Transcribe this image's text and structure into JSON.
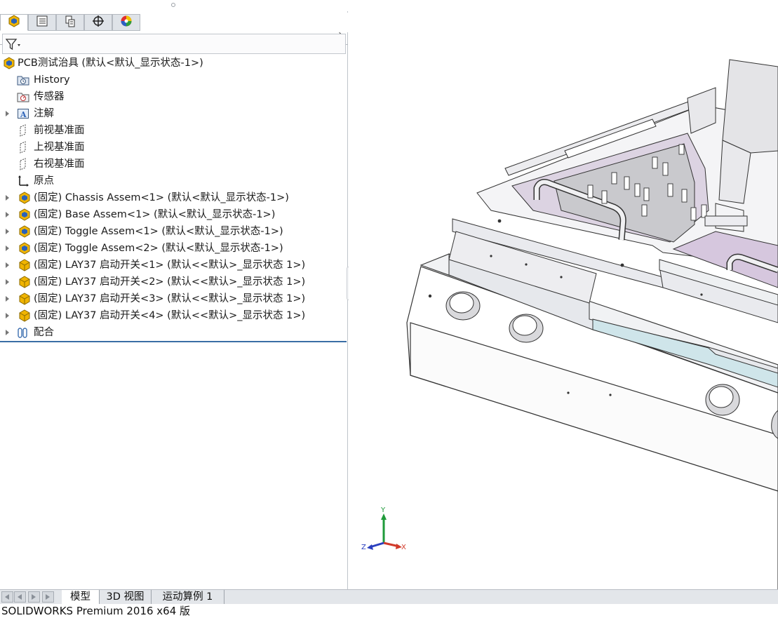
{
  "colors": {
    "accent": "#3a6ea5",
    "assembly_icon": "#f0b400",
    "assembly_icon_blue": "#2b62b8",
    "model_purple": "#d6c7de"
  },
  "panel": {
    "tabs": [
      {
        "name": "feature-manager-tab",
        "icon": "assembly-icon"
      },
      {
        "name": "property-manager-tab",
        "icon": "property-list-icon"
      },
      {
        "name": "configuration-manager-tab",
        "icon": "configuration-icon"
      },
      {
        "name": "dimxpert-tab",
        "icon": "crosshair-icon"
      },
      {
        "name": "display-manager-tab",
        "icon": "color-wheel-icon"
      }
    ],
    "more_glyph": "›",
    "filter_icon": "filter-icon"
  },
  "tree": {
    "root": "PCB测试治具  (默认<默认_显示状态-1>)",
    "items": [
      {
        "label": "History",
        "icon": "history-folder-icon"
      },
      {
        "label": "传感器",
        "icon": "sensor-icon"
      },
      {
        "label": "注解",
        "icon": "annotation-icon"
      },
      {
        "label": "前视基准面",
        "icon": "plane-icon"
      },
      {
        "label": "上视基准面",
        "icon": "plane-icon"
      },
      {
        "label": "右视基准面",
        "icon": "plane-icon"
      },
      {
        "label": "原点",
        "icon": "origin-icon"
      },
      {
        "label": "(固定) Chassis Assem<1> (默认<默认_显示状态-1>)",
        "icon": "assembly-icon"
      },
      {
        "label": "(固定) Base Assem<1> (默认<默认_显示状态-1>)",
        "icon": "assembly-icon"
      },
      {
        "label": "(固定) Toggle Assem<1> (默认<默认_显示状态-1>)",
        "icon": "assembly-icon"
      },
      {
        "label": "(固定) Toggle Assem<2> (默认<默认_显示状态-1>)",
        "icon": "assembly-icon"
      },
      {
        "label": "(固定) LAY37  启动开关<1> (默认<<默认>_显示状态 1>)",
        "icon": "part-icon"
      },
      {
        "label": "(固定) LAY37  启动开关<2> (默认<<默认>_显示状态 1>)",
        "icon": "part-icon"
      },
      {
        "label": "(固定) LAY37  启动开关<3> (默认<<默认>_显示状态 1>)",
        "icon": "part-icon"
      },
      {
        "label": "(固定) LAY37  启动开关<4> (默认<<默认>_显示状态 1>)",
        "icon": "part-icon"
      },
      {
        "label": "配合",
        "icon": "mates-icon"
      }
    ]
  },
  "triad": {
    "x": "X",
    "y": "Y",
    "z": "Z"
  },
  "bottom_tabs": [
    "模型",
    "3D 视图",
    "运动算例 1"
  ],
  "status": "SOLIDWORKS Premium 2016 x64 版"
}
